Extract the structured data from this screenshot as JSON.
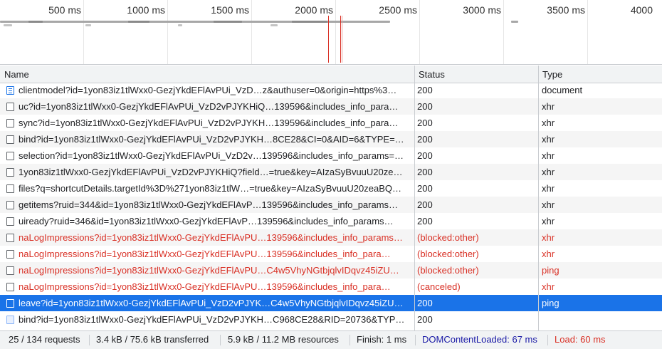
{
  "overview": {
    "ticks": [
      "500 ms",
      "1000 ms",
      "1500 ms",
      "2000 ms",
      "2500 ms",
      "3000 ms",
      "3500 ms",
      "4000"
    ]
  },
  "columns": {
    "name": "Name",
    "status": "Status",
    "type": "Type"
  },
  "rows": [
    {
      "icon": "document-icon",
      "name": "clientmodel?id=1yon83iz1tlWxx0-GezjYkdEFlAvPUi_VzD…z&authuser=0&origin=https%3…",
      "status": "200",
      "type": "document",
      "state": "normal"
    },
    {
      "icon": "request-icon",
      "name": "uc?id=1yon83iz1tlWxx0-GezjYkdEFlAvPUi_VzD2vPJYKHiQ…139596&includes_info_para…",
      "status": "200",
      "type": "xhr",
      "state": "normal"
    },
    {
      "icon": "request-icon",
      "name": "sync?id=1yon83iz1tlWxx0-GezjYkdEFlAvPUi_VzD2vPJYKH…139596&includes_info_para…",
      "status": "200",
      "type": "xhr",
      "state": "normal"
    },
    {
      "icon": "request-icon",
      "name": "bind?id=1yon83iz1tlWxx0-GezjYkdEFlAvPUi_VzD2vPJYKH…8CE28&CI=0&AID=6&TYPE=…",
      "status": "200",
      "type": "xhr",
      "state": "normal"
    },
    {
      "icon": "request-icon",
      "name": "selection?id=1yon83iz1tlWxx0-GezjYkdEFlAvPUi_VzD2v…139596&includes_info_params=…",
      "status": "200",
      "type": "xhr",
      "state": "normal"
    },
    {
      "icon": "request-icon",
      "name": "1yon83iz1tlWxx0-GezjYkdEFlAvPUi_VzD2vPJYKHiQ?field…=true&key=AIzaSyBvuuU20ze…",
      "status": "200",
      "type": "xhr",
      "state": "normal"
    },
    {
      "icon": "request-icon",
      "name": "files?q=shortcutDetails.targetId%3D%271yon83iz1tlW…=true&key=AIzaSyBvuuU20zeaBQ…",
      "status": "200",
      "type": "xhr",
      "state": "normal"
    },
    {
      "icon": "request-icon",
      "name": "getitems?ruid=344&id=1yon83iz1tlWxx0-GezjYkdEFlAvP…139596&includes_info_params…",
      "status": "200",
      "type": "xhr",
      "state": "normal"
    },
    {
      "icon": "request-icon",
      "name": "uiready?ruid=346&id=1yon83iz1tlWxx0-GezjYkdEFlAvP…139596&includes_info_params…",
      "status": "200",
      "type": "xhr",
      "state": "normal"
    },
    {
      "icon": "request-icon",
      "name": "naLogImpressions?id=1yon83iz1tlWxx0-GezjYkdEFlAvPU…139596&includes_info_params…",
      "status": "(blocked:other)",
      "type": "xhr",
      "state": "error"
    },
    {
      "icon": "request-icon",
      "name": "naLogImpressions?id=1yon83iz1tlWxx0-GezjYkdEFlAvPU…139596&includes_info_para…",
      "status": "(blocked:other)",
      "type": "xhr",
      "state": "error"
    },
    {
      "icon": "request-icon",
      "name": "naLogImpressions?id=1yon83iz1tlWxx0-GezjYkdEFlAvPU…C4w5VhyNGtbjqlvIDqvz45iZU…",
      "status": "(blocked:other)",
      "type": "ping",
      "state": "error"
    },
    {
      "icon": "request-icon",
      "name": "naLogImpressions?id=1yon83iz1tlWxx0-GezjYkdEFlAvPU…139596&includes_info_para…",
      "status": "(canceled)",
      "type": "xhr",
      "state": "error"
    },
    {
      "icon": "request-icon",
      "name": "leave?id=1yon83iz1tlWxx0-GezjYkdEFlAvPUi_VzD2vPJYK…C4w5VhyNGtbjqlvIDqvz45iZU…",
      "status": "200",
      "type": "ping",
      "state": "selected"
    },
    {
      "icon": "image-icon",
      "name": "bind?id=1yon83iz1tlWxx0-GezjYkdEFlAvPUi_VzD2vPJYKH…C968CE28&RID=20736&TYP…",
      "status": "200",
      "type": "",
      "state": "normal"
    }
  ],
  "statusbar": {
    "requests": "25 / 134 requests",
    "transferred": "3.4 kB / 75.6 kB transferred",
    "resources": "5.9 kB / 11.2 MB resources",
    "finish": "Finish: 1 ms",
    "domcontentloaded": "DOMContentLoaded: 67 ms",
    "load": "Load: 60 ms"
  },
  "colors": {
    "selected_row": "#1a73e8",
    "error_text": "#d93025",
    "dom_content_loaded": "#1a1aa6",
    "load": "#d93025"
  }
}
